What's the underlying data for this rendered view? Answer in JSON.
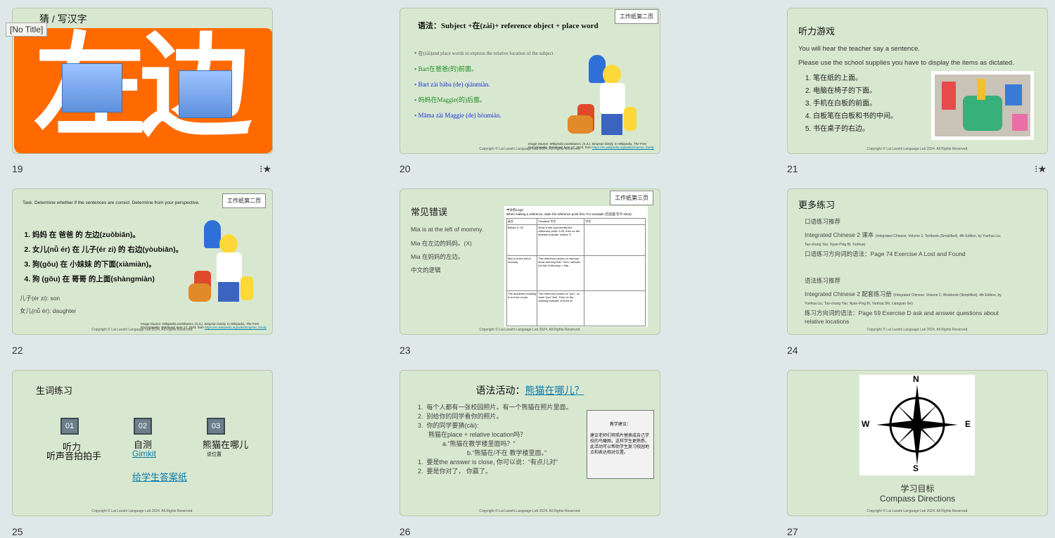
{
  "slides": {
    "s19": {
      "num": "19",
      "title": "猜 / 写汉字",
      "big": "左边",
      "tooltip": "[No Title]"
    },
    "s20": {
      "num": "20",
      "tag": "工作纸第二页",
      "title": "语法：Subject +在(zài)+ reference object +  place word",
      "b1": "在(zài)and place words to express the relative location of the subject",
      "b2": "Bart在爸爸(的)前面。",
      "b3": "Bart zài bàba (de) qiánmiàn.",
      "b4": "妈妈在Maggie(的)后面。",
      "b5": "Māma zài Maggie (de) hòumiàn.",
      "source": "Image Source: Wikipedia contributors. (n.d.). Simpson family. In Wikipedia, The Free Encyclopedia. Retrieved June 17, 2024, from",
      "source_link": "https://en.wikipedia.org/wiki/Simpson_family",
      "copyright": "Copyright © Lai Laoshi Language Lab 2024. All Rights Reserved."
    },
    "s21": {
      "num": "21",
      "title": "听力游戏",
      "p1": "You will hear the teacher say a sentence.",
      "p2": "Please use the school supplies you have to display the items as dictated.",
      "items": [
        "笔在纸的上面。",
        "电脑在椅子的下面。",
        "手机在白板的前面。",
        "白板笔在白板和书的中间。",
        "书在桌子的右边。"
      ],
      "copyright": "Copyright © Lai Laoshi Language Lab 2024. All Rights Reserved."
    },
    "s22": {
      "num": "22",
      "tag": "工作纸第二页",
      "task": "Task. Determine whether if the sentences are correct. Determine from your perspective.",
      "items": [
        "妈妈 在 爸爸 的 左边(zuǒbiān)。",
        "女儿(nǚ ér) 在 儿子(ér zi) 的 右边(yòubiān)。",
        "狗(gǒu) 在 小妹妹 的下面(xiàmiàn)。",
        "狗 (gǒu) 在 哥哥 的上面(shàngmiàn)"
      ],
      "v1": "儿子(ér zi): son",
      "v2": "女儿(nǚ ér): daughter",
      "source": "Image Source: Wikipedia contributors. (n.d.). Simpson family. In Wikipedia, The Free Encyclopedia. Retrieved June 17, 2024, from",
      "source_link": "https://en.wikipedia.org/wiki/Simpson_family",
      "copyright": "Copyright © Lai Laoshi Language Lab 2024. All Rights Reserved."
    },
    "s23": {
      "num": "23",
      "tag": "工作纸第三页",
      "title": "常见错误",
      "l1": "Mia is at the left of mommy.",
      "l2": "Mia 在左边的妈妈。(X)",
      "l3": "Mia 在妈妈的左边。",
      "l4": "中文的逻辑",
      "doc_title": "中文的Logic:",
      "doc_sub": "When making a reference, state the reference point first. For example (在前面 在今 shuō):",
      "headers": [
        "英文",
        "Visualize 中文",
        "中文"
      ],
      "rows": [
        [
          "Before 3: 00",
          "Draw a line and identify the reference point: 3:00, then on the timeline indicate \"before 3\"",
          ""
        ],
        [
          "Mia is at the left of mommy.",
          "The reference person is mommy. Draw mommy first. Then, indicate the left of Mommy = Mia",
          ""
        ],
        [
          "The academic building is in front of you.",
          "The reference person is \"you\", so draw \"you\" first. Then on the drawing indicate \"in front of\"",
          ""
        ]
      ],
      "copyright": "Copyright © Lai Laoshi Language Lab 2024. All Rights Reserved."
    },
    "s24": {
      "num": "24",
      "title": "更多练习",
      "h1": "口语练习推荐",
      "p1": "Integrated Chinese 2 课本",
      "p1s": "(Integrated Chinese, Volume 2, Textbook (Simplified), 4th Edition, by Yuehua Liu, Tao-chung Yao, Nyan-Ping Bi, Yaohua)",
      "p2": "口语练习方向词的语法：Page 74 Exercise A Lost and Found",
      "h2": "语法练习推荐",
      "p3": "Integrated Chinese 2 配套练习册",
      "p3s": "(Integrated Chinese, Volume 2, Workbook (Simplified), 4th Edition, by Yuehua Liu, Tao-chung Yao, Nyan-Ping Bi, Yaohua Shi, Liangyan Ge)",
      "p4": "练习方向词的语法：Page 59 Exercise D ask and answer questions about relative locations",
      "copyright": "Copyright © Lai Laoshi Language Lab 2024. All Rights Reserved."
    },
    "s25": {
      "num": "25",
      "title": "生词练习",
      "b1": "01",
      "b2": "02",
      "b3": "03",
      "t1a": "听力",
      "t1b": "听声音拍拍手",
      "t2a": "自测",
      "t2b": "Gimkit",
      "t3a": "熊猫在哪儿",
      "t3b": "说位置",
      "link": "给学生答案纸",
      "copyright": "Copyright © Lai Laoshi Language Lab 2024. All Rights Reserved."
    },
    "s26": {
      "num": "26",
      "title_a": "语法活动：",
      "title_b": "熊猫在哪儿？",
      "l1": "每个人都有一张校园照片。有一个熊猫在照片里面。",
      "l2": "别给你的同学看你的照片。",
      "l3": "你的同学要猜(cāi):",
      "l3b": "熊猫在place + relative location吗？",
      "l3c": "a.“熊猫在教学楼里面吗？”",
      "l3d": "b.“熊猫在/不在 教学楼里面。”",
      "l4": "要是the answer is close, 你可以说：“有点儿对”",
      "l5": "要是你对了， 你赢了。",
      "box_title": "教学建议：",
      "box_body": "建议老师们将照片替换成自己学校的鸟瞰图，这样学生更熟悉。此活动可以帮助学生复习校园地点和表达相对位置。",
      "copyright": "Copyright © Lai Laoshi Language Lab 2024. All Rights Reserved."
    },
    "s27": {
      "num": "27",
      "n": "N",
      "s": "S",
      "e": "E",
      "w": "W",
      "t1": "学习目标",
      "t2": "Compass Directions",
      "copyright": "Copyright © Lai Laoshi Language Lab 2024. All Rights Reserved."
    }
  }
}
